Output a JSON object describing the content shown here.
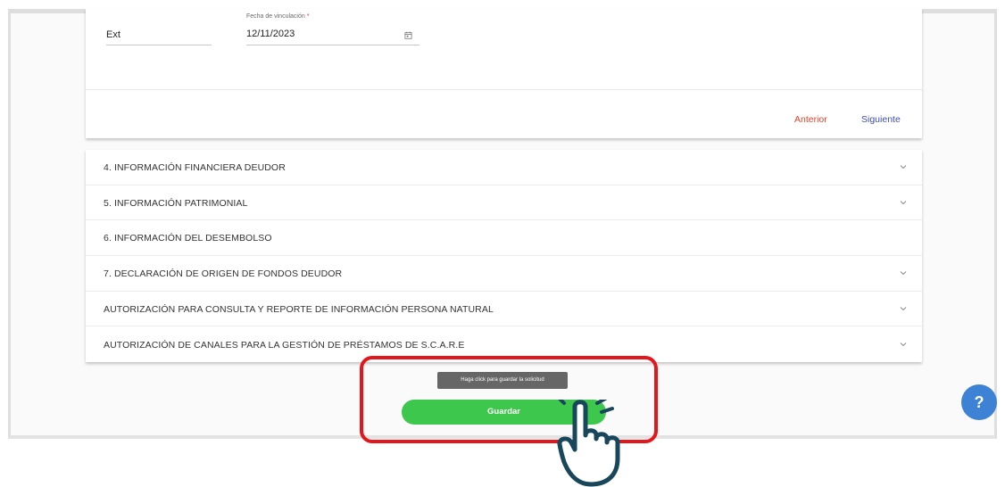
{
  "form": {
    "ext_value": "Ext",
    "date_label": "Fecha de vinculación",
    "date_required_mark": "*",
    "date_value": "12/11/2023"
  },
  "nav": {
    "prev_label": "Anterior",
    "next_label": "Siguiente"
  },
  "accordion": {
    "items": [
      {
        "label": "4. INFORMACIÓN FINANCIERA DEUDOR",
        "icon": "chevron-down-icon"
      },
      {
        "label": "5. INFORMACIÓN PATRIMONIAL",
        "icon": "chevron-down-icon"
      },
      {
        "label": "6. INFORMACIÓN DEL DESEMBOLSO",
        "icon": ""
      },
      {
        "label": "7. DECLARACIÓN DE ORIGEN DE FONDOS DEUDOR",
        "icon": "chevron-down-icon"
      },
      {
        "label": "AUTORIZACIÓN PARA CONSULTA Y REPORTE DE INFORMACIÓN PERSONA NATURAL",
        "icon": "chevron-down-icon"
      },
      {
        "label": "AUTORIZACIÓN DE CANALES PARA LA GESTIÓN DE PRÉSTAMOS DE S.C.A.R.E",
        "icon": "chevron-down-icon"
      }
    ]
  },
  "save": {
    "tooltip": "Haga click para guardar la solicitud",
    "button_label": "Guardar"
  },
  "help": {
    "label": "?"
  },
  "colors": {
    "save_button": "#3dc74c",
    "prev_button": "#e0452e",
    "next_button": "#3e4bb6",
    "highlight_border": "#e3161c",
    "help_button": "#3d82d4",
    "required_mark": "#e53935"
  }
}
